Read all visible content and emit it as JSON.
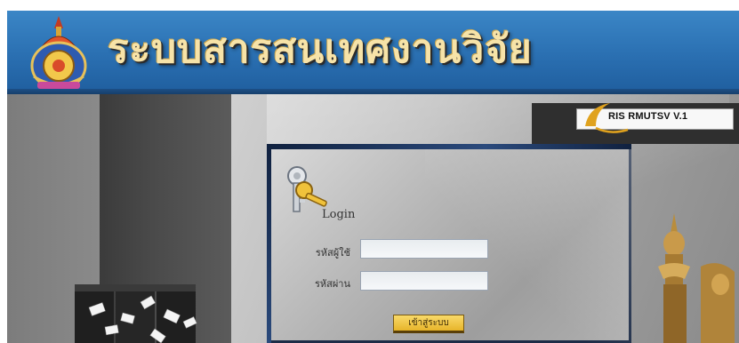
{
  "header": {
    "title": "ระบบสารสนเทศงานวิจัย",
    "logo_icon": "university-seal-icon"
  },
  "version_badge": {
    "text": "RIS RMUTSV V.1"
  },
  "login": {
    "heading": "Login",
    "username_label": "รหัสผู้ใช้",
    "username_value": "",
    "password_label": "รหัสผ่าน",
    "password_value": "",
    "submit_label": "เข้าสู่ระบบ",
    "icon": "key-icon"
  },
  "decorations": {
    "left_art": "server-documents-illustration",
    "right_art": "thai-statue-illustration"
  },
  "colors": {
    "header_blue": "#2a6fb1",
    "title_gold": "#f7e3a8",
    "button_gold": "#e7b52a",
    "panel_border_navy": "#10213f"
  }
}
